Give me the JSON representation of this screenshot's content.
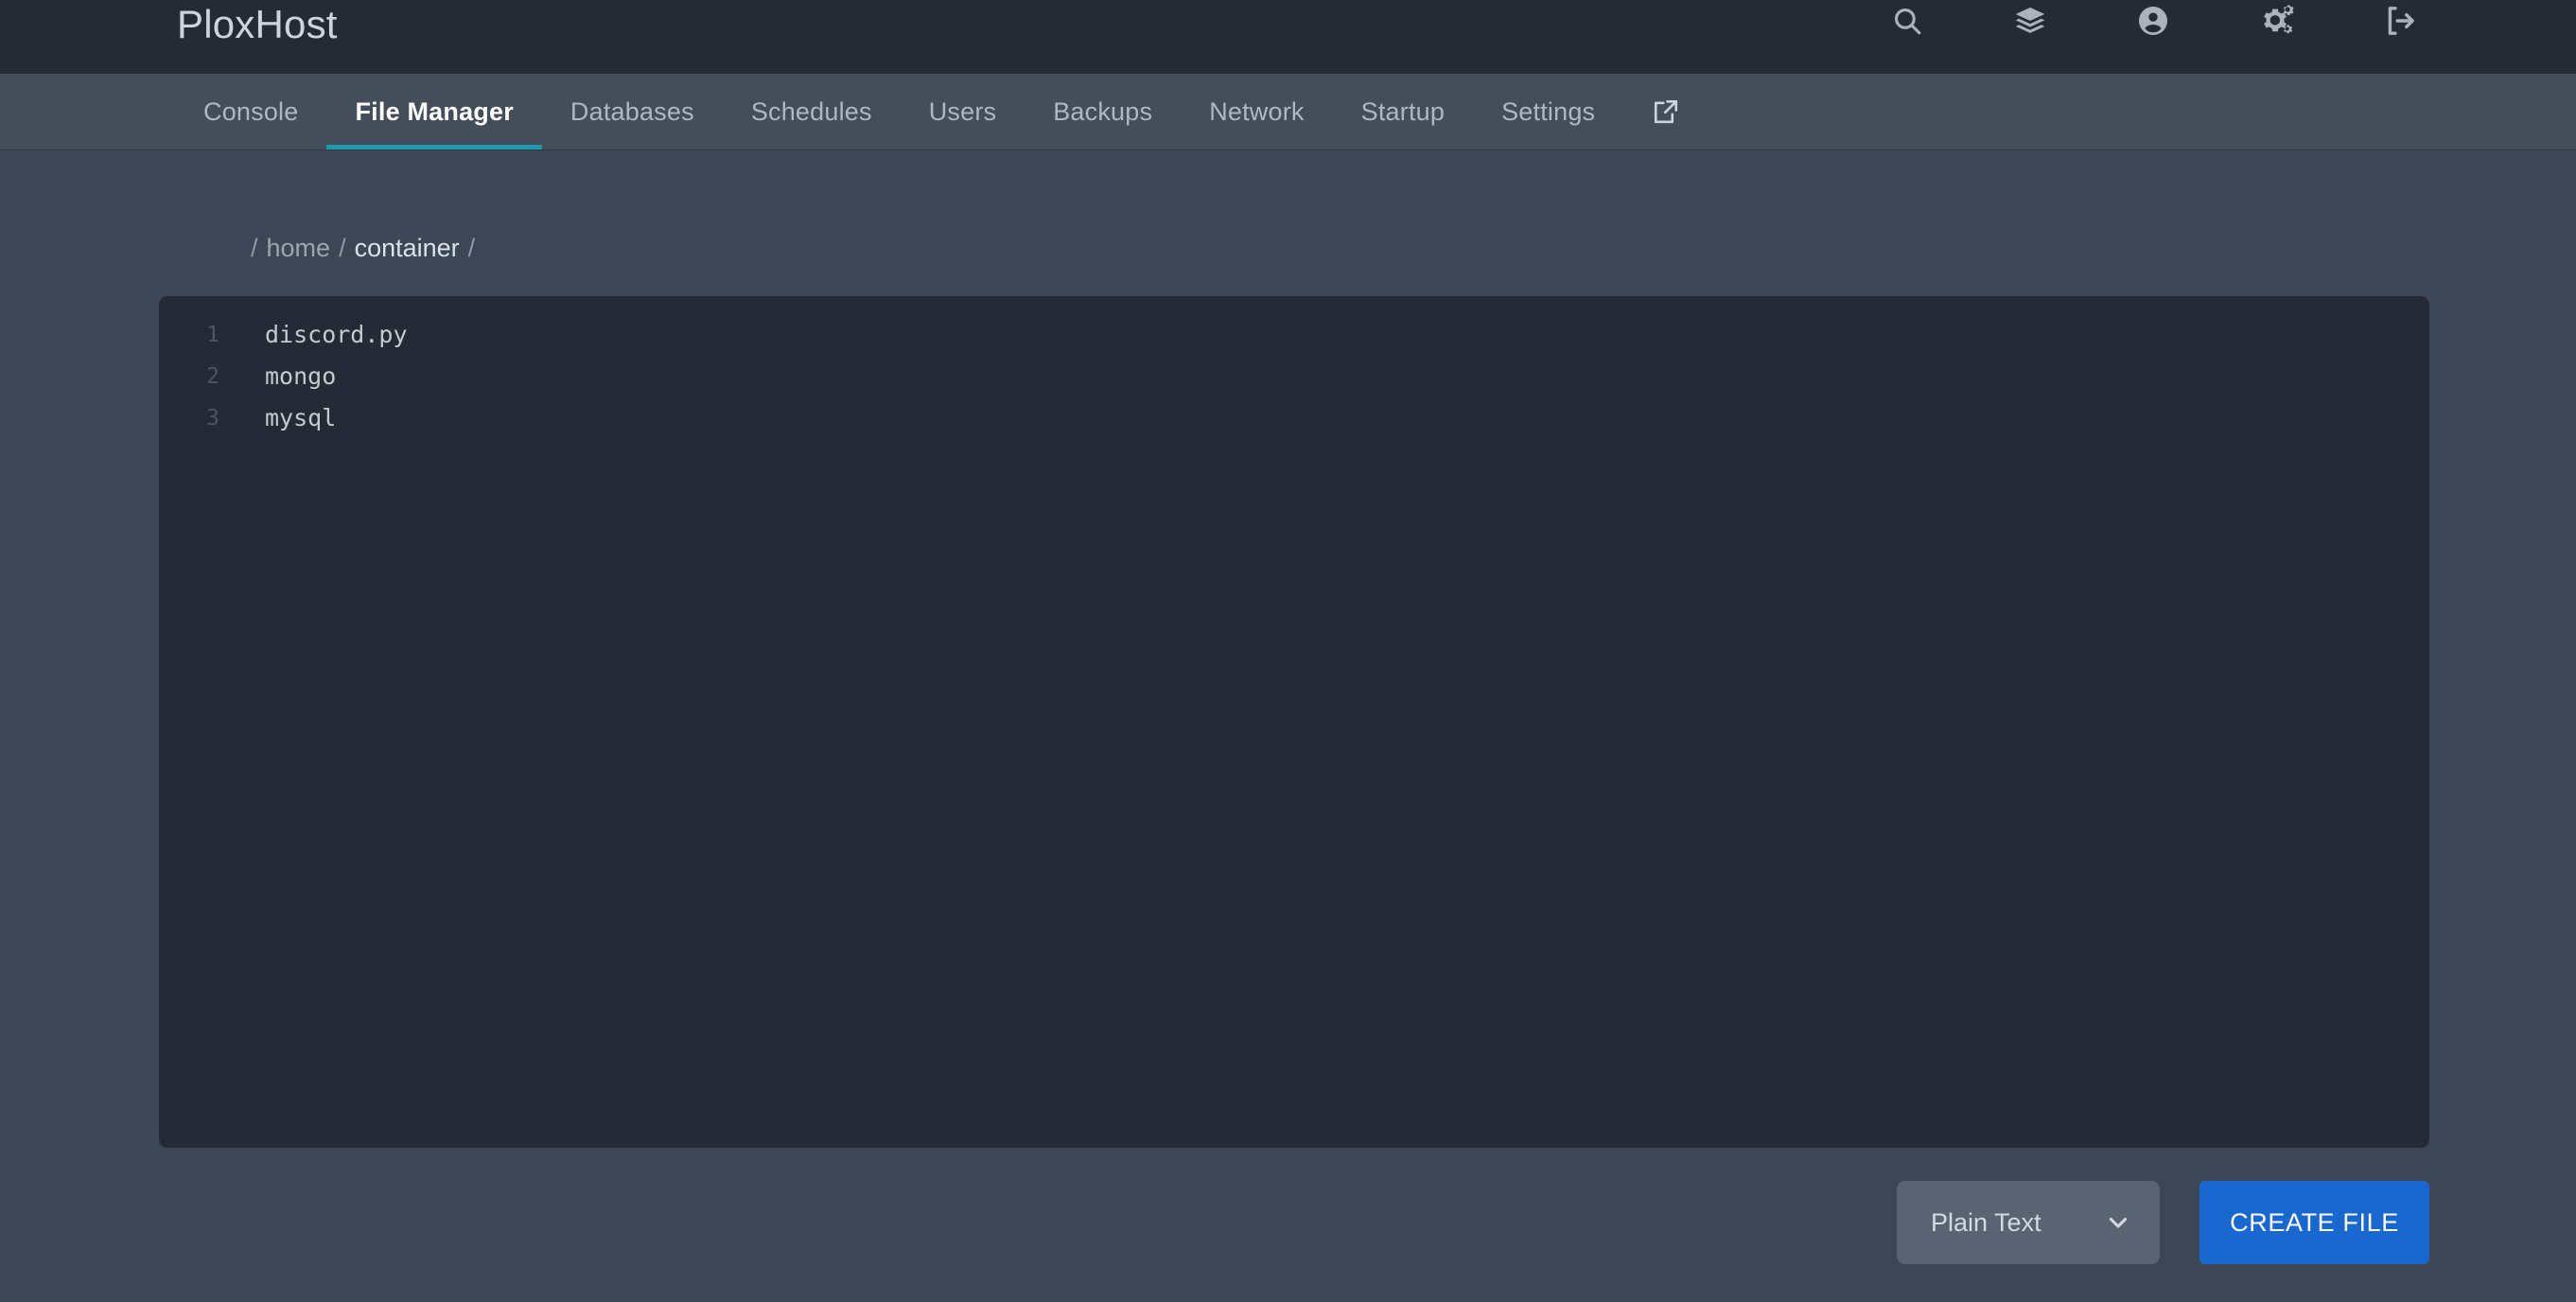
{
  "header": {
    "brand": "PloxHost",
    "icons": [
      {
        "name": "search-icon",
        "label": "Search"
      },
      {
        "name": "layers-icon",
        "label": "Servers"
      },
      {
        "name": "account-circle-icon",
        "label": "Account"
      },
      {
        "name": "cogs-icon",
        "label": "Admin"
      },
      {
        "name": "logout-icon",
        "label": "Sign Out"
      }
    ]
  },
  "nav": {
    "tabs": [
      {
        "label": "Console",
        "active": false
      },
      {
        "label": "File Manager",
        "active": true
      },
      {
        "label": "Databases",
        "active": false
      },
      {
        "label": "Schedules",
        "active": false
      },
      {
        "label": "Users",
        "active": false
      },
      {
        "label": "Backups",
        "active": false
      },
      {
        "label": "Network",
        "active": false
      },
      {
        "label": "Startup",
        "active": false
      },
      {
        "label": "Settings",
        "active": false
      }
    ],
    "external_link_icon": "external-link-icon",
    "active_underline_color": "#1a9aab"
  },
  "breadcrumb": {
    "lead_separator": "/",
    "items": [
      {
        "label": "home",
        "current": false
      },
      {
        "label": "container",
        "current": true
      }
    ],
    "separator": "/",
    "trailing_separator": "/"
  },
  "editor": {
    "lines": [
      {
        "number": "1",
        "text": "discord.py"
      },
      {
        "number": "2",
        "text": "mongo"
      },
      {
        "number": "3",
        "text": "mysql"
      }
    ],
    "background_color": "#252b36"
  },
  "actions": {
    "language_select": {
      "value": "Plain Text",
      "chevron_icon": "chevron-down-icon"
    },
    "create_file_label": "CREATE FILE",
    "create_file_color": "#1868d0"
  }
}
